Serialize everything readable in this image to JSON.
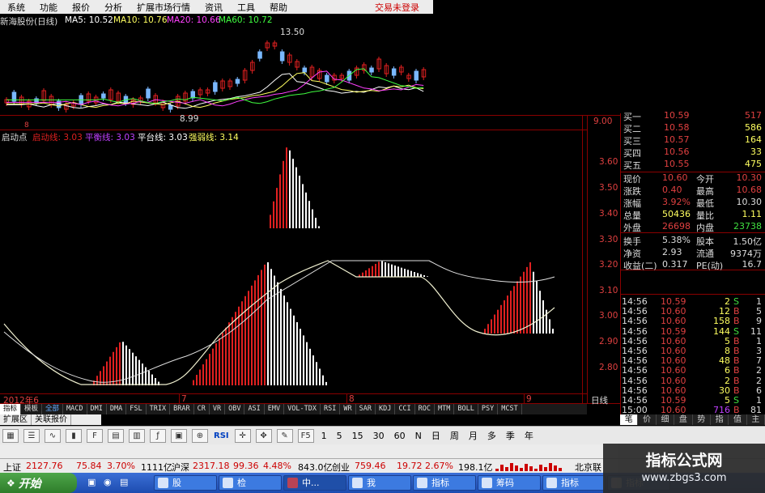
{
  "menu": {
    "items": [
      "系统",
      "功能",
      "报价",
      "分析",
      "扩展市场行情",
      "资讯",
      "工具",
      "帮助"
    ],
    "trade": "交易未登录"
  },
  "top_chart": {
    "stock_label": "新海股份(日线)",
    "ma5": "MA5: 10.52",
    "ma10": "MA10: 10.76",
    "ma20": "MA20: 10.66",
    "ma60": "MA60: 10.72",
    "high_label": "13.50",
    "low_label": "8.99",
    "marker": "8"
  },
  "indicator": {
    "title": "启动点",
    "l1": "启动线: 3.03",
    "l2": "平衡线: 3.03",
    "l3": "平台线: 3.03",
    "l4": "强弱线: 3.14"
  },
  "axis": {
    "y": [
      "3.60",
      "3.50",
      "3.40",
      "3.30",
      "3.20",
      "3.10",
      "3.00",
      "2.90",
      "2.80"
    ],
    "top_y": "9.00",
    "x_start": "2012年6",
    "x7": "7",
    "x8": "8",
    "x9": "9",
    "period": "日线"
  },
  "quote": {
    "rows": [
      {
        "a": "买一",
        "b": "10.59",
        "c": "517",
        "cb": "#e04040"
      },
      {
        "a": "买二",
        "b": "10.58",
        "c": "586",
        "cb": "#e04040"
      },
      {
        "a": "买三",
        "b": "10.57",
        "c": "164",
        "cb": "#ffff60"
      },
      {
        "a": "买四",
        "b": "10.56",
        "c": "33",
        "cb": "#ffff60"
      },
      {
        "a": "买五",
        "b": "10.55",
        "c": "475",
        "cb": "#ffff60"
      }
    ],
    "stats": [
      {
        "a": "现价",
        "b": "10.60",
        "c": "今开",
        "d": "10.30"
      },
      {
        "a": "涨跌",
        "b": "0.40",
        "c": "最高",
        "d": "10.68"
      },
      {
        "a": "涨幅",
        "b": "3.92%",
        "c": "最低",
        "d": "10.30"
      },
      {
        "a": "总量",
        "b": "50436",
        "c": "量比",
        "d": "1.11"
      },
      {
        "a": "外盘",
        "b": "26698",
        "c": "内盘",
        "d": "23738"
      }
    ],
    "stats2": [
      {
        "a": "换手",
        "b": "5.38%",
        "c": "股本",
        "d": "1.50亿"
      },
      {
        "a": "净资",
        "b": "2.93",
        "c": "流通",
        "d": "9374万"
      },
      {
        "a": "收益(二)",
        "b": "0.317",
        "c": "PE(动)",
        "d": "16.7"
      }
    ]
  },
  "ticks": [
    {
      "t": "14:56",
      "p": "10.59",
      "v": "2",
      "s": "S",
      "n": "1"
    },
    {
      "t": "14:56",
      "p": "10.60",
      "v": "12",
      "s": "B",
      "n": "5"
    },
    {
      "t": "14:56",
      "p": "10.60",
      "v": "158",
      "s": "B",
      "n": "9"
    },
    {
      "t": "14:56",
      "p": "10.59",
      "v": "144",
      "s": "S",
      "n": "11"
    },
    {
      "t": "14:56",
      "p": "10.60",
      "v": "5",
      "s": "B",
      "n": "1"
    },
    {
      "t": "14:56",
      "p": "10.60",
      "v": "8",
      "s": "B",
      "n": "3"
    },
    {
      "t": "14:56",
      "p": "10.60",
      "v": "48",
      "s": "B",
      "n": "7"
    },
    {
      "t": "14:56",
      "p": "10.60",
      "v": "6",
      "s": "B",
      "n": "2"
    },
    {
      "t": "14:56",
      "p": "10.60",
      "v": "2",
      "s": "B",
      "n": "2"
    },
    {
      "t": "14:56",
      "p": "10.60",
      "v": "30",
      "s": "B",
      "n": "6"
    },
    {
      "t": "14:56",
      "p": "10.59",
      "v": "5",
      "s": "S",
      "n": "1"
    },
    {
      "t": "15:00",
      "p": "10.60",
      "v": "716",
      "s": "B",
      "n": "81"
    }
  ],
  "ind_tabs": [
    "指标",
    "模板",
    "全部",
    "MACD",
    "DMI",
    "DMA",
    "FSL",
    "TRIX",
    "BRAR",
    "CR",
    "VR",
    "OBV",
    "ASI",
    "EMV",
    "VOL-TDX",
    "RSI",
    "WR",
    "SAR",
    "KDJ",
    "CCI",
    "ROC",
    "MTM",
    "BOLL",
    "PSY",
    "MCST"
  ],
  "subtabs": [
    "扩展区",
    "关联报价"
  ],
  "rtabs": [
    "笔",
    "价",
    "细",
    "盘",
    "势",
    "指",
    "值",
    "主"
  ],
  "toolbar": {
    "periods": [
      "1",
      "5",
      "15",
      "30",
      "60",
      "N",
      "日",
      "周",
      "月",
      "多",
      "季",
      "年"
    ],
    "rsi": "RSI"
  },
  "status": {
    "sh_name": "上证",
    "sh_val": "2127.76",
    "sh_chg": "75.84",
    "sh_pct": "3.70%",
    "sh_amt": "1111亿",
    "sz_name": "沪深",
    "sz_val": "2317.18",
    "sz_chg": "99.36",
    "sz_pct": "4.48%",
    "sz_amt": "843.0亿",
    "cy_name": "创业",
    "cy_val": "759.46",
    "cy_chg": "19.72",
    "cy_pct": "2.67%",
    "cy_amt": "198.1亿",
    "bj": "北京联"
  },
  "taskbar": {
    "start": "开始",
    "tasks": [
      "股",
      "检",
      "中...",
      "我",
      "指标",
      "筹码",
      "指标",
      "指标"
    ]
  },
  "watermark": {
    "title": "指标公式网",
    "url": "www.zbgs3.com"
  },
  "colors": {
    "up": "#e02020",
    "down": "#ffffff",
    "border": "#8a0000"
  }
}
